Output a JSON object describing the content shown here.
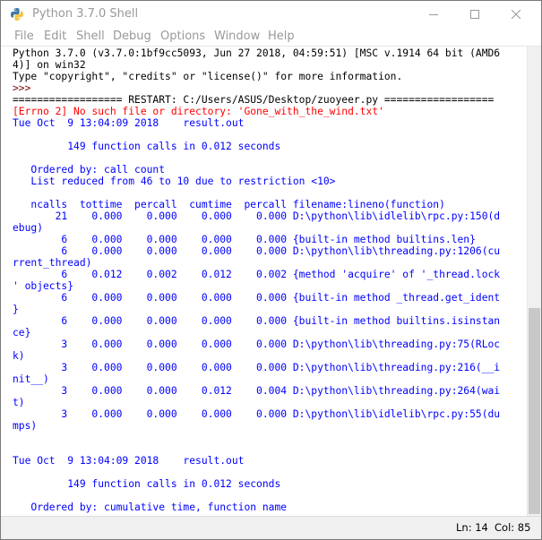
{
  "window": {
    "title": "Python 3.7.0 Shell"
  },
  "menu": [
    "File",
    "Edit",
    "Shell",
    "Debug",
    "Options",
    "Window",
    "Help"
  ],
  "shell": {
    "banner_line1": "Python 3.7.0 (v3.7.0:1bf9cc5093, Jun 27 2018, 04:59:51) [MSC v.1914 64 bit (AMD6",
    "banner_line2": "4)] on win32",
    "banner_line3": "Type \"copyright\", \"credits\" or \"license()\" for more information.",
    "prompt": ">>> ",
    "restart": "================== RESTART: C:/Users/ASUS/Desktop/zuoyeer.py ==================",
    "error": "[Errno 2] No such file or directory: 'Gone_with_the_wind.txt'",
    "stats_block": "Tue Oct  9 13:04:09 2018    result.out\n\n         149 function calls in 0.012 seconds\n\n   Ordered by: call count\n   List reduced from 46 to 10 due to restriction <10>\n\n   ncalls  tottime  percall  cumtime  percall filename:lineno(function)\n       21    0.000    0.000    0.000    0.000 D:\\python\\lib\\idlelib\\rpc.py:150(d\nebug)\n        6    0.000    0.000    0.000    0.000 {built-in method builtins.len}\n        6    0.000    0.000    0.000    0.000 D:\\python\\lib\\threading.py:1206(cu\nrrent_thread)\n        6    0.012    0.002    0.012    0.002 {method 'acquire' of '_thread.lock\n' objects}\n        6    0.000    0.000    0.000    0.000 {built-in method _thread.get_ident\n}\n        6    0.000    0.000    0.000    0.000 {built-in method builtins.isinstan\nce}\n        3    0.000    0.000    0.000    0.000 D:\\python\\lib\\threading.py:75(RLoc\nk)\n        3    0.000    0.000    0.000    0.000 D:\\python\\lib\\threading.py:216(__i\nnit__)\n        3    0.000    0.000    0.012    0.004 D:\\python\\lib\\threading.py:264(wai\nt)\n        3    0.000    0.000    0.000    0.000 D:\\python\\lib\\idlelib\\rpc.py:55(du\nmps)\n\n\nTue Oct  9 13:04:09 2018    result.out\n\n         149 function calls in 0.012 seconds\n\n   Ordered by: cumulative time, function name"
  },
  "status": {
    "line": "Ln: 14",
    "col": "Col: 85"
  },
  "colors": {
    "stdout": "#0000ff",
    "stderr": "#ff0000",
    "prompt": "#800000",
    "menu_text": "#999999"
  }
}
